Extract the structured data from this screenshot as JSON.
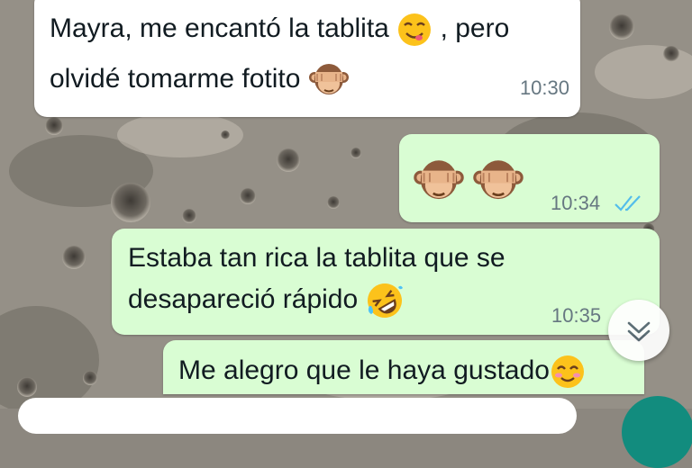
{
  "chat": {
    "messages": [
      {
        "direction": "incoming",
        "line1_before_emoji": "Mayra, me encantó la tablita",
        "line1_after_emoji": ", pero",
        "line2": "olvidé tomarme fotito",
        "emojis": [
          "smiling-face-savoring-food",
          "see-no-evil-monkey"
        ],
        "time": "10:30"
      },
      {
        "direction": "outgoing",
        "emojis": [
          "see-no-evil-monkey",
          "see-no-evil-monkey"
        ],
        "time": "10:34",
        "status": "read"
      },
      {
        "direction": "outgoing",
        "line1": "Estaba tan rica la tablita que se",
        "line2": "desapareció rápido",
        "emojis": [
          "rolling-on-the-floor-laughing"
        ],
        "time": "10:35",
        "status": "read"
      },
      {
        "direction": "outgoing",
        "line1": "Me alegro que le haya gustado",
        "emojis": [
          "smiling-face-with-smiling-eyes"
        ]
      }
    ]
  },
  "colors": {
    "incoming_bubble": "#ffffff",
    "outgoing_bubble": "#d9fdd3",
    "read_ticks": "#53bdeb",
    "timestamp": "#667781"
  },
  "icons": [
    "double-check-icon",
    "chevron-double-down-icon",
    "moon-wallpaper"
  ]
}
